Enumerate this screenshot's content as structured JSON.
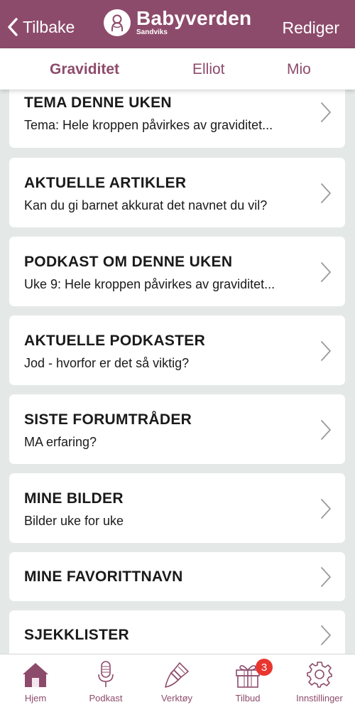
{
  "header": {
    "back_label": "Tilbake",
    "brand_name": "Babyverden",
    "brand_sub": "Sandviks",
    "edit_label": "Rediger"
  },
  "tabs": [
    {
      "label": "Graviditet",
      "active": true
    },
    {
      "label": "Elliot",
      "active": false
    },
    {
      "label": "Mio",
      "active": false
    }
  ],
  "cards": [
    {
      "title": "TEMA DENNE UKEN",
      "subtitle": "Tema: Hele kroppen påvirkes av graviditet..."
    },
    {
      "title": "AKTUELLE ARTIKLER",
      "subtitle": "Kan du gi barnet akkurat det navnet du vil?"
    },
    {
      "title": "PODKAST OM DENNE UKEN",
      "subtitle": "Uke 9: Hele kroppen påvirkes av graviditet..."
    },
    {
      "title": "AKTUELLE PODKASTER",
      "subtitle": "Jod - hvorfor er det så viktig?"
    },
    {
      "title": "SISTE FORUMTRÅDER",
      "subtitle": "MA erfaring?"
    },
    {
      "title": "MINE BILDER",
      "subtitle": "Bilder uke for uke"
    },
    {
      "title": "MINE FAVORITTNAVN"
    },
    {
      "title": "SJEKKLISTER"
    }
  ],
  "bottom_nav": [
    {
      "label": "Hjem",
      "icon": "home-icon",
      "active": true
    },
    {
      "label": "Podkast",
      "icon": "microphone-icon"
    },
    {
      "label": "Verktøy",
      "icon": "brush-icon"
    },
    {
      "label": "Tilbud",
      "icon": "gift-icon",
      "badge": "3"
    },
    {
      "label": "Innstillinger",
      "icon": "gear-icon"
    }
  ],
  "colors": {
    "brand": "#8d4b6b",
    "background": "#e4e9e8",
    "badge": "#e8362f"
  }
}
